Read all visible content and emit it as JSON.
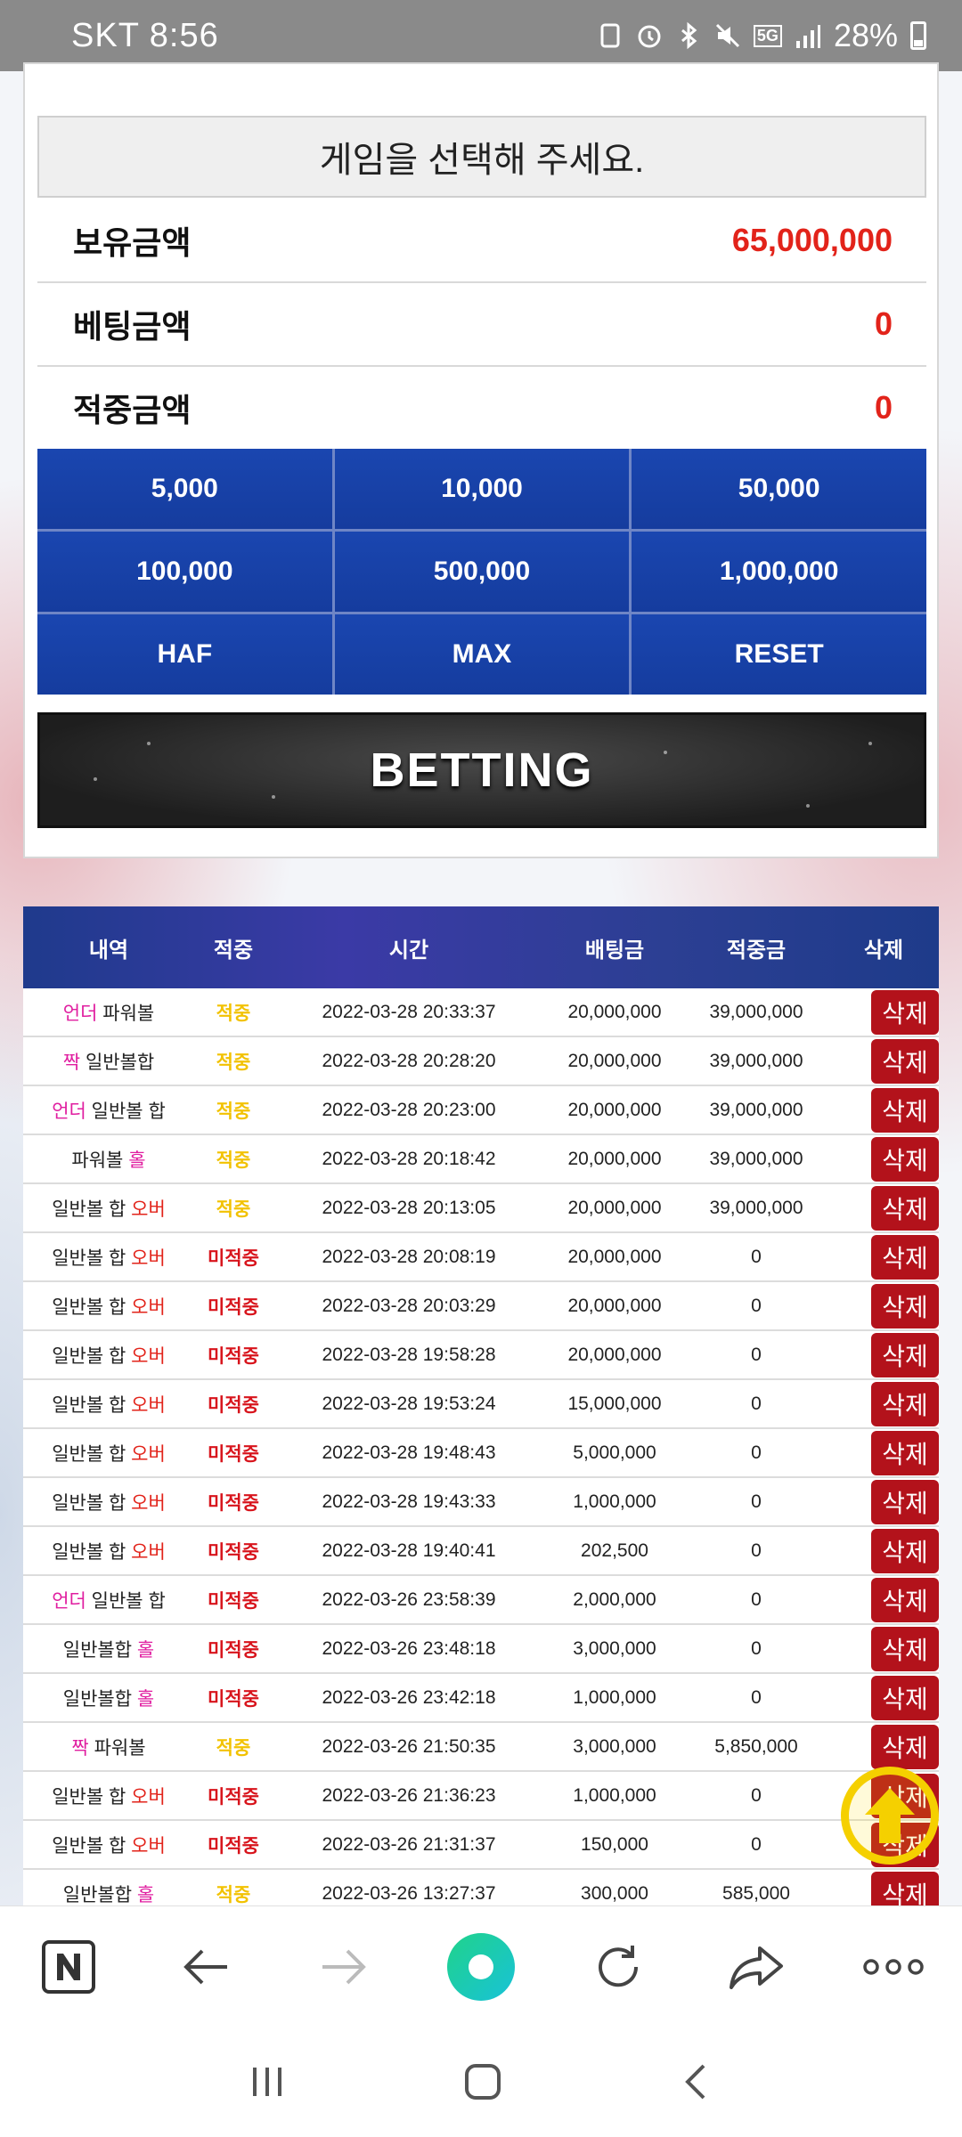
{
  "status_bar": {
    "carrier_time": "SKT 8:56",
    "battery_percent": "28%",
    "network": "5G"
  },
  "panel": {
    "game_select": "게임을 선택해 주세요.",
    "balance_label": "보유금액",
    "balance_value": "65,000,000",
    "bet_label": "베팅금액",
    "bet_value": "0",
    "win_label": "적중금액",
    "win_value": "0",
    "chips": [
      "5,000",
      "10,000",
      "50,000",
      "100,000",
      "500,000",
      "1,000,000",
      "HAF",
      "MAX",
      "RESET"
    ],
    "betting_button": "BETTING"
  },
  "table": {
    "headers": [
      "내역",
      "적중",
      "시간",
      "배팅금",
      "적중금",
      "삭제"
    ],
    "delete_label": "삭제",
    "rows": [
      {
        "pick_a": "언더",
        "pick_b": "파워볼",
        "accent_first": true,
        "result": "적중",
        "hit": true,
        "time": "2022-03-28 20:33:37",
        "bet": "20,000,000",
        "win": "39,000,000"
      },
      {
        "pick_a": "짝",
        "pick_b": "일반볼합",
        "accent_first": true,
        "result": "적중",
        "hit": true,
        "time": "2022-03-28 20:28:20",
        "bet": "20,000,000",
        "win": "39,000,000"
      },
      {
        "pick_a": "언더",
        "pick_b": "일반볼 합",
        "accent_first": true,
        "result": "적중",
        "hit": true,
        "time": "2022-03-28 20:23:00",
        "bet": "20,000,000",
        "win": "39,000,000"
      },
      {
        "pick_a": "파워볼",
        "pick_b": "홀",
        "accent_first": false,
        "result": "적중",
        "hit": true,
        "time": "2022-03-28 20:18:42",
        "bet": "20,000,000",
        "win": "39,000,000"
      },
      {
        "pick_a": "일반볼 합",
        "pick_b": "오버",
        "accent_first": false,
        "result": "적중",
        "hit": true,
        "time": "2022-03-28 20:13:05",
        "bet": "20,000,000",
        "win": "39,000,000"
      },
      {
        "pick_a": "일반볼 합",
        "pick_b": "오버",
        "accent_first": false,
        "result": "미적중",
        "hit": false,
        "time": "2022-03-28 20:08:19",
        "bet": "20,000,000",
        "win": "0"
      },
      {
        "pick_a": "일반볼 합",
        "pick_b": "오버",
        "accent_first": false,
        "result": "미적중",
        "hit": false,
        "time": "2022-03-28 20:03:29",
        "bet": "20,000,000",
        "win": "0"
      },
      {
        "pick_a": "일반볼 합",
        "pick_b": "오버",
        "accent_first": false,
        "result": "미적중",
        "hit": false,
        "time": "2022-03-28 19:58:28",
        "bet": "20,000,000",
        "win": "0"
      },
      {
        "pick_a": "일반볼 합",
        "pick_b": "오버",
        "accent_first": false,
        "result": "미적중",
        "hit": false,
        "time": "2022-03-28 19:53:24",
        "bet": "15,000,000",
        "win": "0"
      },
      {
        "pick_a": "일반볼 합",
        "pick_b": "오버",
        "accent_first": false,
        "result": "미적중",
        "hit": false,
        "time": "2022-03-28 19:48:43",
        "bet": "5,000,000",
        "win": "0"
      },
      {
        "pick_a": "일반볼 합",
        "pick_b": "오버",
        "accent_first": false,
        "result": "미적중",
        "hit": false,
        "time": "2022-03-28 19:43:33",
        "bet": "1,000,000",
        "win": "0"
      },
      {
        "pick_a": "일반볼 합",
        "pick_b": "오버",
        "accent_first": false,
        "result": "미적중",
        "hit": false,
        "time": "2022-03-28 19:40:41",
        "bet": "202,500",
        "win": "0"
      },
      {
        "pick_a": "언더",
        "pick_b": "일반볼 합",
        "accent_first": true,
        "result": "미적중",
        "hit": false,
        "time": "2022-03-26 23:58:39",
        "bet": "2,000,000",
        "win": "0"
      },
      {
        "pick_a": "일반볼합",
        "pick_b": "홀",
        "accent_first": false,
        "result": "미적중",
        "hit": false,
        "time": "2022-03-26 23:48:18",
        "bet": "3,000,000",
        "win": "0"
      },
      {
        "pick_a": "일반볼합",
        "pick_b": "홀",
        "accent_first": false,
        "result": "미적중",
        "hit": false,
        "time": "2022-03-26 23:42:18",
        "bet": "1,000,000",
        "win": "0"
      },
      {
        "pick_a": "짝",
        "pick_b": "파워볼",
        "accent_first": true,
        "result": "적중",
        "hit": true,
        "time": "2022-03-26 21:50:35",
        "bet": "3,000,000",
        "win": "5,850,000"
      },
      {
        "pick_a": "일반볼 합",
        "pick_b": "오버",
        "accent_first": false,
        "result": "미적중",
        "hit": false,
        "time": "2022-03-26 21:36:23",
        "bet": "1,000,000",
        "win": "0"
      },
      {
        "pick_a": "일반볼 합",
        "pick_b": "오버",
        "accent_first": false,
        "result": "미적중",
        "hit": false,
        "time": "2022-03-26 21:31:37",
        "bet": "150,000",
        "win": "0"
      },
      {
        "pick_a": "일반볼합",
        "pick_b": "홀",
        "accent_first": false,
        "result": "적중",
        "hit": true,
        "time": "2022-03-26 13:27:37",
        "bet": "300,000",
        "win": "585,000"
      }
    ]
  },
  "colors": {
    "accent_pink": "#e01ea0",
    "hit_yellow": "#f2c200",
    "miss_red": "#d8141c",
    "chip_blue": "#1a46b0",
    "delete_red": "#b3121b"
  },
  "browser_bar": {
    "icons": [
      "naver-icon",
      "back-icon",
      "forward-icon",
      "home-icon",
      "reload-icon",
      "share-icon",
      "more-icon"
    ]
  }
}
